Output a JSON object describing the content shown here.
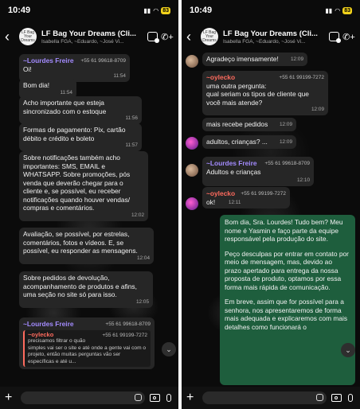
{
  "status": {
    "time": "10:49",
    "battery": "83"
  },
  "chat": {
    "title": "LF Bag Your Dreams (Cli...",
    "subtitle": "Isabella FGA, ~Eduardo, ~José Vi...",
    "avatar_text": "LF Bag Your Dreams"
  },
  "left": {
    "m1": {
      "sender": "~Lourdes Freire",
      "phone": "+55 61 99618-8709",
      "text": "Oi!",
      "time": "11:54"
    },
    "m2": {
      "text": "Bom dia!",
      "time": "11:54"
    },
    "m3": {
      "text": "Acho importante que esteja sincronizado com o estoque",
      "time": "11:56"
    },
    "m4": {
      "text": "Formas de pagamento: Pix, cartão débito e crédito e boleto",
      "time": "11:57"
    },
    "m5": {
      "text": "Sobre notificações também acho importantes: SMS, EMAIL e WHATSAPP. Sobre promoções, pós venda que deverão chegar para o cliente e, se possível, eu receber notificações quando houver vendas/ compras e comentários.",
      "time": "12:02"
    },
    "m6": {
      "text": "Avaliação, se possível, por estrelas, comentários, fotos e vídeos. E, se possível, eu responder as mensagens.",
      "time": "12:04"
    },
    "m7": {
      "text": "Sobre pedidos de devolução, acompanhamento de produtos e afins, uma seção no site só para isso.",
      "time": "12:05"
    },
    "m8": {
      "sender": "~Lourdes Freire",
      "phone": "+55 61 99618-8709",
      "quote_sender": "~oylecko",
      "quote_phone": "+55 61 99199-7272",
      "quote_text": "precisamos filtrar o quão simples vai ser o site e até onde a gente vai com o projeto, então muitas perguntas vão ser específicas e até u..."
    }
  },
  "right": {
    "r1": {
      "text": "Agradeço imensamente!",
      "time": "12:09"
    },
    "r2": {
      "sender": "~oylecko",
      "phone": "+55 61 99199-7272",
      "text": "uma outra pergunta: qual seriam os tipos de cliente que você mais atende?",
      "time": "12:09"
    },
    "r3": {
      "text": "mais recebe pedidos",
      "time": "12:09"
    },
    "r4": {
      "text": "adultos, crianças? ...",
      "time": "12:09"
    },
    "r5": {
      "sender": "~Lourdes Freire",
      "phone": "+55 61 99618-8709",
      "text": "Adultos e crianças",
      "time": "12:10"
    },
    "r6": {
      "sender": "~oylecko",
      "phone": "+55 61 99199-7272",
      "text": "ok!",
      "time": "12:11"
    },
    "r7": {
      "p1": "Bom dia, Sra. Lourdes! Tudo bem? Meu nome é Yasmin e faço parte da equipe responsável pela produção do site.",
      "p2": "Peço desculpas por entrar em contato por meio de mensagem, mas, devido ao prazo apertado para entrega da nossa proposta de produto, optamos por essa forma mais rápida de comunicação.",
      "p3": "Em breve, assim que for possível para a senhora, nos apresentaremos de forma mais adequada e explicaremos com mais detalhes como funcionará o"
    }
  },
  "colors": {
    "incoming": "#262626",
    "outgoing": "#1e5e3d",
    "purple_name": "#a38bff",
    "red_name": "#ff6b5e",
    "battery": "#f2d21b"
  },
  "icons": [
    "back-icon",
    "video-call-icon",
    "add-call-icon",
    "plus-icon",
    "sticker-icon",
    "camera-icon",
    "mic-icon",
    "chevron-down-icon"
  ]
}
